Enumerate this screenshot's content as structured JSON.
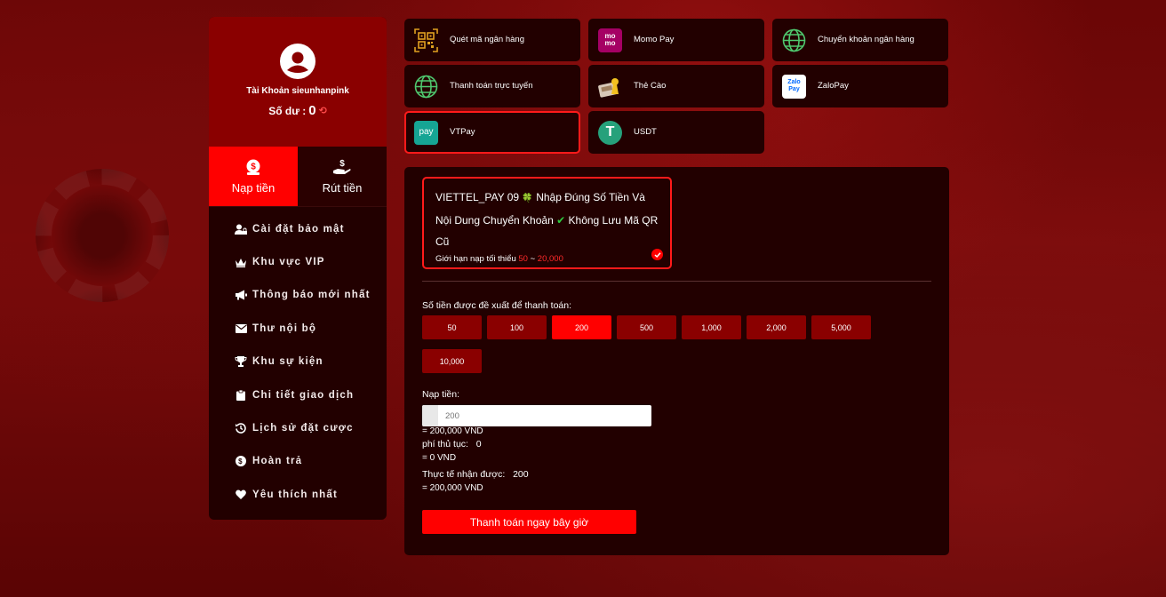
{
  "colors": {
    "accent": "#ff0000",
    "panel": "#220000",
    "profile": "#8a0000"
  },
  "profile": {
    "account_label": "Tài Khoản sieunhanpink",
    "balance_label": "Số dư :",
    "balance_value": "0"
  },
  "tabs": [
    {
      "label": "Nạp tiền",
      "icon": "money-bag-icon",
      "active": true
    },
    {
      "label": "Rút tiền",
      "icon": "hand-money-icon",
      "active": false
    }
  ],
  "menu": [
    {
      "label": "Cài đặt bảo mật",
      "icon": "user-lock-icon"
    },
    {
      "label": "Khu vực VIP",
      "icon": "crown-icon"
    },
    {
      "label": "Thông báo mới nhất",
      "icon": "megaphone-icon"
    },
    {
      "label": "Thư nội bộ",
      "icon": "envelope-icon"
    },
    {
      "label": "Khu sự kiện",
      "icon": "trophy-icon"
    },
    {
      "label": "Chi tiết giao dịch",
      "icon": "clipboard-icon"
    },
    {
      "label": "Lịch sử đặt cược",
      "icon": "history-icon"
    },
    {
      "label": "Hoàn trả",
      "icon": "coin-icon"
    },
    {
      "label": "Yêu thích nhất",
      "icon": "heart-icon"
    }
  ],
  "methods": [
    {
      "label": "Quét mã ngân hàng",
      "icon": "qr-code-icon"
    },
    {
      "label": "Momo Pay",
      "icon": "momo-icon",
      "icon_text": "mo mo"
    },
    {
      "label": "Chuyển khoản ngân hàng",
      "icon": "globe-icon"
    },
    {
      "label": "Thanh toán trực tuyến",
      "icon": "globe-icon"
    },
    {
      "label": "Thẻ Cào",
      "icon": "scratch-card-icon"
    },
    {
      "label": "ZaloPay",
      "icon": "zalopay-icon",
      "icon_text": "Zalo Pay"
    },
    {
      "label": "VTPay",
      "icon": "vtpay-icon",
      "icon_text": "pay",
      "active": true
    },
    {
      "label": "USDT",
      "icon": "tether-icon",
      "icon_text": "T"
    }
  ],
  "channel": {
    "name": "VIETTEL_PAY 09",
    "clover": "🍀",
    "note_1": "Nhập Đúng Số Tiền Và Nội Dung Chuyển Khoản",
    "checkmark": "✔",
    "note_2": "Không Lưu Mã QR Cũ",
    "limit_label": "Giới hạn nạp tối thiểu",
    "limit_min": "50",
    "limit_sep": "~",
    "limit_max": "20,000"
  },
  "suggest_label": "Số tiền được đề xuất để thanh toán:",
  "amounts": [
    {
      "label": "50"
    },
    {
      "label": "100"
    },
    {
      "label": "200",
      "active": true
    },
    {
      "label": "500"
    },
    {
      "label": "1,000"
    },
    {
      "label": "2,000"
    },
    {
      "label": "5,000"
    },
    {
      "label": "10,000"
    }
  ],
  "deposit": {
    "label": "Nạp tiền:",
    "placeholder": "200",
    "equivalent": "= 200,000 VND",
    "fee_label": "phí thủ tục:",
    "fee_value": "0",
    "fee_equivalent": "= 0 VND",
    "received_label": "Thực tế nhận được:",
    "received_value": "200",
    "received_equivalent": "= 200,000 VND"
  },
  "pay_button": "Thanh toán ngay bây giờ"
}
